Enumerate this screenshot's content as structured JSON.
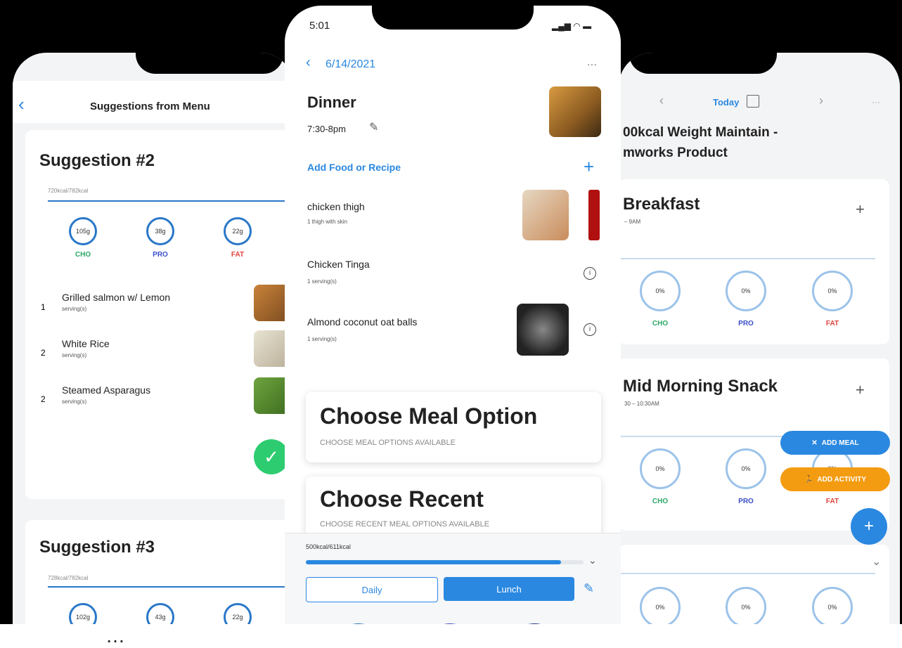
{
  "left": {
    "title": "Suggestions from Menu",
    "back_icon": "chevron-left",
    "s2": {
      "heading": "Suggestion #2",
      "kcal": "720kcal/782kcal",
      "macros": [
        {
          "value": "105g",
          "label": "CHO"
        },
        {
          "value": "38g",
          "label": "PRO"
        },
        {
          "value": "22g",
          "label": "FAT"
        }
      ],
      "items": [
        {
          "qty": "1",
          "name": "Grilled salmon w/ Lemon",
          "unit": "serving(s)"
        },
        {
          "qty": "2",
          "name": "White Rice",
          "unit": "serving(s)"
        },
        {
          "qty": "2",
          "name": "Steamed Asparagus",
          "unit": "serving(s)"
        }
      ]
    },
    "s3": {
      "heading": "Suggestion #3",
      "kcal": "728kcal/782kcal",
      "macros": [
        {
          "value": "102g",
          "label": "CHO"
        },
        {
          "value": "43g",
          "label": "PRO"
        },
        {
          "value": "22g",
          "label": "FAT"
        }
      ]
    }
  },
  "mid": {
    "status": {
      "time": "5:01"
    },
    "date": "6/14/2021",
    "more": "···",
    "meal": {
      "title": "Dinner",
      "time": "7:30-8pm"
    },
    "add_food": "Add Food or Recipe",
    "add_plus": "+",
    "foods": [
      {
        "name": "chicken thigh",
        "detail": "1 thigh with skin"
      },
      {
        "name": "Chicken Tinga",
        "detail": "1 serving(s)"
      },
      {
        "name": "Almond coconut oat balls",
        "detail": "1 serving(s)"
      }
    ],
    "choose_option": {
      "title": "Choose Meal Option",
      "subtitle": "CHOOSE MEAL OPTIONS AVAILABLE"
    },
    "choose_recent": {
      "title": "Choose Recent",
      "subtitle": "CHOOSE RECENT MEAL OPTIONS AVAILABLE"
    },
    "summary": {
      "kcal": "500kcal/611kcal",
      "progress": 0.92
    },
    "tabs": [
      {
        "label": "Daily"
      },
      {
        "label": "Lunch"
      }
    ]
  },
  "right": {
    "nav": {
      "today": "Today",
      "more": "···"
    },
    "plan_line1": "00kcal Weight Maintain -",
    "plan_line2": "mworks Product",
    "breakfast": {
      "title": "Breakfast",
      "time": "– 9AM",
      "plus": "+",
      "macros": [
        {
          "value": "0%",
          "label": "CHO"
        },
        {
          "value": "0%",
          "label": "PRO"
        },
        {
          "value": "0%",
          "label": "FAT"
        }
      ]
    },
    "snack": {
      "title": "Mid Morning Snack",
      "time": "30 – 10:30AM",
      "plus": "+",
      "macros": [
        {
          "value": "0%",
          "label": "CHO"
        },
        {
          "value": "0%",
          "label": "PRO"
        },
        {
          "value": "0%",
          "label": "FAT"
        }
      ]
    },
    "third": {
      "macros": [
        {
          "value": "0%"
        },
        {
          "value": "0%"
        },
        {
          "value": "0%"
        }
      ]
    },
    "fab_meal": "ADD MEAL",
    "fab_activity": "ADD ACTIVITY",
    "fab_plus": "+"
  },
  "caption": "…"
}
